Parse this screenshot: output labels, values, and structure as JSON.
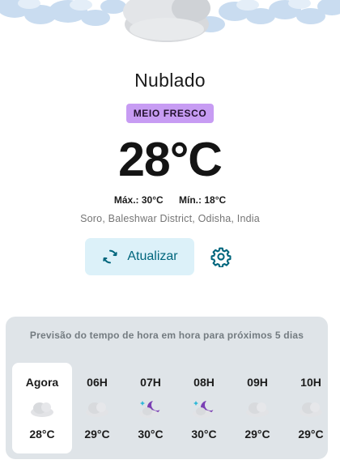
{
  "weather": {
    "condition": "Nublado",
    "feel_badge": "MEIO FRESCO",
    "temperature": "28°C",
    "max_label": "Máx.: 30°C",
    "min_label": "Mín.: 18°C",
    "location": "Soro, Baleshwar District, Odisha, India"
  },
  "actions": {
    "refresh_label": "Atualizar"
  },
  "forecast": {
    "title": "Previsão do tempo de hora em hora para próximos 5 dias",
    "hours": [
      {
        "label": "Agora",
        "temp": "28°C",
        "icon": "cloudy-icon"
      },
      {
        "label": "06H",
        "temp": "29°C",
        "icon": "cloudy-icon"
      },
      {
        "label": "07H",
        "temp": "30°C",
        "icon": "night-cloud-icon"
      },
      {
        "label": "08H",
        "temp": "30°C",
        "icon": "night-cloud-icon"
      },
      {
        "label": "09H",
        "temp": "29°C",
        "icon": "cloudy-icon"
      },
      {
        "label": "10H",
        "temp": "29°C",
        "icon": "cloudy-icon"
      }
    ]
  },
  "colors": {
    "badge": "#c79cf3",
    "refresh_bg": "#dcf1f9",
    "accent": "#00667d",
    "card_bg": "#dfe4e8"
  }
}
